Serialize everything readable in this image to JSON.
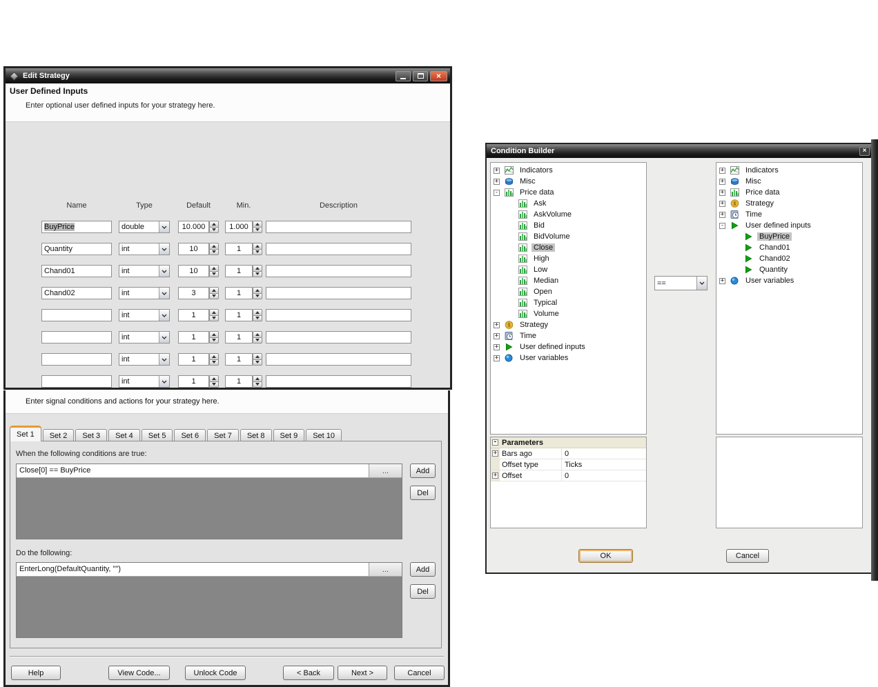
{
  "edit_strategy": {
    "title": "Edit Strategy",
    "heading": "User Defined Inputs",
    "subheading": "Enter optional user defined inputs for your strategy here.",
    "window_controls": [
      "minimize",
      "maximize",
      "close"
    ],
    "columns": [
      "Name",
      "Type",
      "Default",
      "Min.",
      "Description"
    ],
    "rows": [
      {
        "name": "BuyPrice",
        "type": "double",
        "default": "10.000",
        "min": "1.000",
        "description": "",
        "name_selected": true
      },
      {
        "name": "Quantity",
        "type": "int",
        "default": "10",
        "min": "1",
        "description": ""
      },
      {
        "name": "Chand01",
        "type": "int",
        "default": "10",
        "min": "1",
        "description": ""
      },
      {
        "name": "Chand02",
        "type": "int",
        "default": "3",
        "min": "1",
        "description": ""
      },
      {
        "name": "",
        "type": "int",
        "default": "1",
        "min": "1",
        "description": ""
      },
      {
        "name": "",
        "type": "int",
        "default": "1",
        "min": "1",
        "description": ""
      },
      {
        "name": "",
        "type": "int",
        "default": "1",
        "min": "1",
        "description": ""
      },
      {
        "name": "",
        "type": "int",
        "default": "1",
        "min": "1",
        "description": ""
      }
    ],
    "buttons": [
      "Help",
      "View Code...",
      "Unlock Code",
      "< Back",
      "Next >",
      "Cancel"
    ]
  },
  "signal_page": {
    "intro": "Enter signal conditions and actions for your strategy here.",
    "tabs": [
      "Set 1",
      "Set 2",
      "Set 3",
      "Set 4",
      "Set 5",
      "Set 6",
      "Set 7",
      "Set 8",
      "Set 9",
      "Set 10"
    ],
    "active_tab_index": 0,
    "conditions_label": "When the following conditions are true:",
    "conditions": [
      "Close[0] == BuyPrice"
    ],
    "actions_label": "Do the following:",
    "actions": [
      "EnterLong(DefaultQuantity, \"\")"
    ],
    "more_label": "...",
    "add_label": "Add",
    "del_label": "Del",
    "buttons": [
      "Help",
      "View Code...",
      "Unlock Code",
      "< Back",
      "Next >",
      "Cancel"
    ]
  },
  "condition_builder": {
    "title": "Condition Builder",
    "window_controls": [
      "close"
    ],
    "operator": "==",
    "left_tree": [
      {
        "label": "Indicators",
        "icon": "indicators",
        "expand": "+",
        "level": 0
      },
      {
        "label": "Misc",
        "icon": "misc",
        "expand": "+",
        "level": 0
      },
      {
        "label": "Price data",
        "icon": "bars",
        "expand": "-",
        "level": 0
      },
      {
        "label": "Ask",
        "icon": "bars",
        "level": 1
      },
      {
        "label": "AskVolume",
        "icon": "bars",
        "level": 1
      },
      {
        "label": "Bid",
        "icon": "bars",
        "level": 1
      },
      {
        "label": "BidVolume",
        "icon": "bars",
        "level": 1
      },
      {
        "label": "Close",
        "icon": "bars",
        "level": 1,
        "selected": true
      },
      {
        "label": "High",
        "icon": "bars",
        "level": 1
      },
      {
        "label": "Low",
        "icon": "bars",
        "level": 1
      },
      {
        "label": "Median",
        "icon": "bars",
        "level": 1
      },
      {
        "label": "Open",
        "icon": "bars",
        "level": 1
      },
      {
        "label": "Typical",
        "icon": "bars",
        "level": 1
      },
      {
        "label": "Volume",
        "icon": "bars",
        "level": 1
      },
      {
        "label": "Strategy",
        "icon": "strategy",
        "expand": "+",
        "level": 0
      },
      {
        "label": "Time",
        "icon": "time",
        "expand": "+",
        "level": 0
      },
      {
        "label": "User defined inputs",
        "icon": "input",
        "expand": "+",
        "level": 0
      },
      {
        "label": "User variables",
        "icon": "variable",
        "expand": "+",
        "level": 0
      }
    ],
    "right_tree": [
      {
        "label": "Indicators",
        "icon": "indicators",
        "expand": "+",
        "level": 0
      },
      {
        "label": "Misc",
        "icon": "misc",
        "expand": "+",
        "level": 0
      },
      {
        "label": "Price data",
        "icon": "bars",
        "expand": "+",
        "level": 0
      },
      {
        "label": "Strategy",
        "icon": "strategy",
        "expand": "+",
        "level": 0
      },
      {
        "label": "Time",
        "icon": "time",
        "expand": "+",
        "level": 0
      },
      {
        "label": "User defined inputs",
        "icon": "input",
        "expand": "-",
        "level": 0
      },
      {
        "label": "BuyPrice",
        "icon": "input",
        "level": 1,
        "selected": true
      },
      {
        "label": "Chand01",
        "icon": "input",
        "level": 1
      },
      {
        "label": "Chand02",
        "icon": "input",
        "level": 1
      },
      {
        "label": "Quantity",
        "icon": "input",
        "level": 1
      },
      {
        "label": "User variables",
        "icon": "variable",
        "expand": "+",
        "level": 0
      }
    ],
    "parameters": {
      "header": "Parameters",
      "header_expand": "-",
      "rows": [
        {
          "expand": "+",
          "label": "Bars ago",
          "value": "0"
        },
        {
          "expand": "",
          "label": "Offset type",
          "value": "Ticks"
        },
        {
          "expand": "+",
          "label": "Offset",
          "value": "0"
        }
      ]
    },
    "ok_label": "OK",
    "cancel_label": "Cancel"
  },
  "colors": {
    "accent_orange": "#e89b2f",
    "close_red": "#bf3a20",
    "selection_gray": "#c3c3c3",
    "list_empty_gray": "#868686",
    "param_header_beige": "#ece9d8"
  }
}
